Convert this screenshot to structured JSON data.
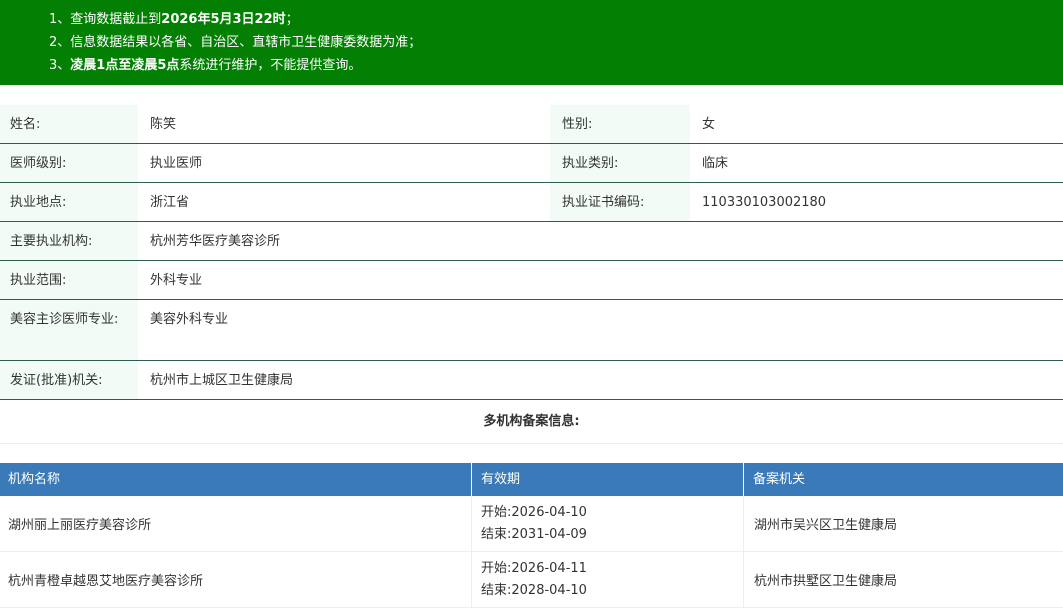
{
  "notice": {
    "line1": {
      "prefix": "1、查询数据截止到",
      "bold": "2026年5月3日22时",
      "suffix": "；"
    },
    "line2": "2、信息数据结果以各省、自治区、直辖市卫生健康委数据为准；",
    "line3": {
      "prefix": "3、",
      "bold": "凌晨1点至凌晨5点",
      "suffix": "系统进行维护，不能提供查询。"
    }
  },
  "info": {
    "name_label": "姓名:",
    "name_value": "陈笑",
    "gender_label": "性别:",
    "gender_value": "女",
    "level_label": "医师级别:",
    "level_value": "执业医师",
    "category_label": "执业类别:",
    "category_value": "临床",
    "location_label": "执业地点:",
    "location_value": "浙江省",
    "cert_label": "执业证书编码:",
    "cert_value": "110330103002180",
    "institution_label": "主要执业机构:",
    "institution_value": "杭州芳华医疗美容诊所",
    "scope_label": "执业范围:",
    "scope_value": "外科专业",
    "cosmetic_label": "美容主诊医师专业:",
    "cosmetic_value": "美容外科专业",
    "authority_label": "发证(批准)机关:",
    "authority_value": "杭州市上城区卫生健康局"
  },
  "multi": {
    "title": "多机构备案信息:",
    "headers": {
      "name": "机构名称",
      "validity": "有效期",
      "authority": "备案机关"
    },
    "rows": [
      {
        "name": "湖州丽上丽医疗美容诊所",
        "start_label": "开始:",
        "start": "2026-04-10",
        "end_label": "结束:",
        "end": "2031-04-09",
        "authority": "湖州市吴兴区卫生健康局"
      },
      {
        "name": "杭州青橙卓越恩艾地医疗美容诊所",
        "start_label": "开始:",
        "start": "2026-04-11",
        "end_label": "结束:",
        "end": "2028-04-10",
        "authority": "杭州市拱墅区卫生健康局"
      }
    ]
  },
  "colors": {
    "notice_bg": "#038003",
    "label_bg": "#f2fbf5",
    "header_bg": "#3a7ab8"
  }
}
